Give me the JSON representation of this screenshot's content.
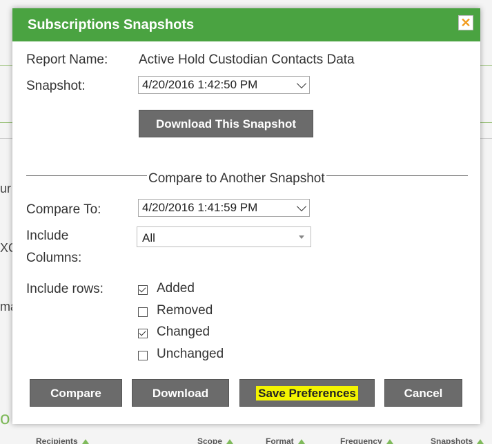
{
  "background": {
    "fragments": [
      "ur",
      "XC",
      "ma"
    ],
    "green_fragment": "o",
    "footer_columns": [
      "Recipients",
      "Scope",
      "Format",
      "Frequency",
      "Snapshots"
    ]
  },
  "dialog": {
    "title": "Subscriptions Snapshots",
    "close_symbol": "✕",
    "report_name_label": "Report Name:",
    "report_name_value": "Active Hold Custodian Contacts Data",
    "snapshot_label": "Snapshot:",
    "snapshot_value": "4/20/2016 1:42:50 PM",
    "download_snapshot_label": "Download This Snapshot",
    "compare_section_title": "Compare to Another Snapshot",
    "compare_to_label": "Compare To:",
    "compare_to_value": "4/20/2016 1:41:59 PM",
    "include_columns_label_1": "Include",
    "include_columns_label_2": "Columns:",
    "include_columns_value": "All",
    "include_rows_label": "Include rows:",
    "rows_options": [
      {
        "label": "Added",
        "checked": true
      },
      {
        "label": "Removed",
        "checked": false
      },
      {
        "label": "Changed",
        "checked": true
      },
      {
        "label": "Unchanged",
        "checked": false
      }
    ],
    "buttons": {
      "compare": "Compare",
      "download": "Download",
      "save_preferences": "Save Preferences",
      "cancel": "Cancel"
    }
  },
  "colors": {
    "header_green": "#4aa341",
    "button_gray": "#6b6b6b",
    "highlight_yellow": "#f3f400",
    "close_orange": "#f29c1f"
  }
}
